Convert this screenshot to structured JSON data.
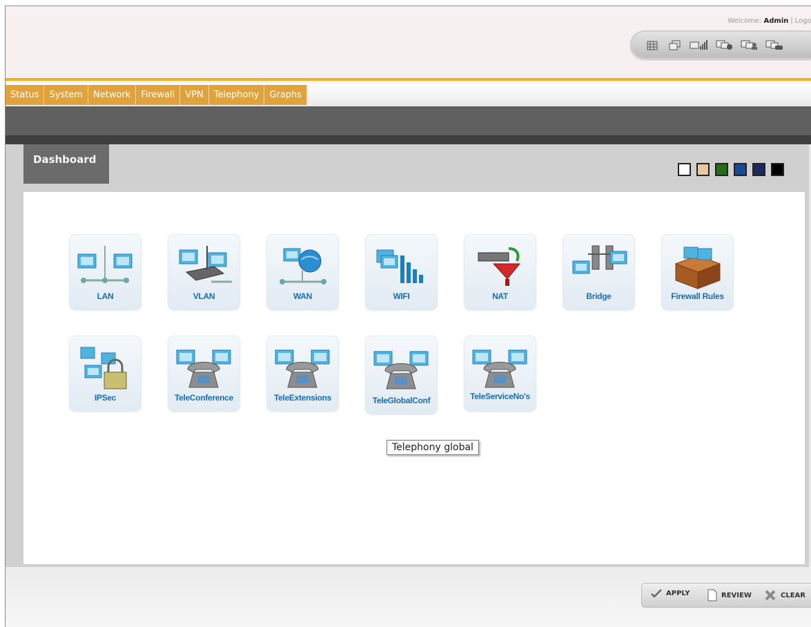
{
  "header": {
    "welcome_label": "Welcome:",
    "user": "Admin",
    "separator": "|",
    "logout_label": "Logout",
    "toolbar_icons": [
      "grid-icon",
      "windows-icon",
      "signal-icon",
      "network-status-icon",
      "users-icon",
      "phone-monitor-icon"
    ]
  },
  "nav": {
    "items": [
      "Status",
      "System",
      "Network",
      "Firewall",
      "VPN",
      "Telephony",
      "Graphs"
    ]
  },
  "dashboard": {
    "tab_label": "Dashboard",
    "theme_colors": [
      "#ffffff",
      "#e8c8a0",
      "#2a6a1a",
      "#1a4b90",
      "#1b2a5a",
      "#000000"
    ],
    "tiles_row1": [
      {
        "label": "LAN",
        "icon": "lan-icon"
      },
      {
        "label": "VLAN",
        "icon": "vlan-icon"
      },
      {
        "label": "WAN",
        "icon": "wan-icon"
      },
      {
        "label": "WIFI",
        "icon": "wifi-icon"
      },
      {
        "label": "NAT",
        "icon": "nat-icon"
      },
      {
        "label": "Bridge",
        "icon": "bridge-icon"
      },
      {
        "label": "Firewall Rules",
        "icon": "firewall-icon"
      }
    ],
    "tiles_row2": [
      {
        "label": "IPSec",
        "icon": "ipsec-icon"
      },
      {
        "label": "TeleConference",
        "icon": "telephone-icon"
      },
      {
        "label": "TeleExtensions",
        "icon": "telephone-icon"
      },
      {
        "label": "TeleGlobalConf",
        "icon": "telephone-icon"
      },
      {
        "label": "TeleServiceNo's",
        "icon": "telephone-icon"
      }
    ],
    "tooltip": "Telephony global"
  },
  "actions": {
    "apply": "APPLY",
    "review": "REVIEW",
    "clear": "CLEAR"
  }
}
